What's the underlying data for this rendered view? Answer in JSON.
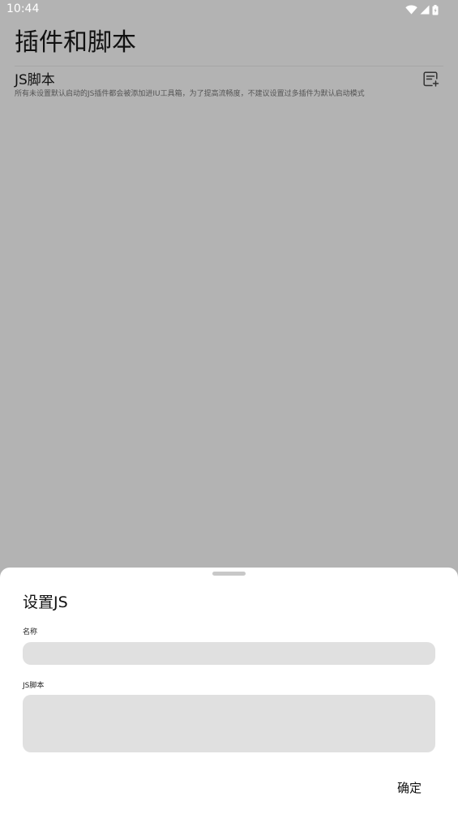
{
  "status_bar": {
    "time": "10:44",
    "icons": [
      "wifi-icon",
      "signal-icon",
      "battery-icon"
    ]
  },
  "page": {
    "title": "插件和脚本",
    "section": {
      "title": "JS脚本",
      "description": "所有未设置默认启动的JS插件都会被添加进IU工具箱，为了提高流畅度，不建议设置过多插件为默认启动模式",
      "action_icon": "add-note-icon"
    }
  },
  "sheet": {
    "title": "设置JS",
    "name_label": "名称",
    "name_value": "",
    "js_label": "JS脚本",
    "js_value": "",
    "confirm_label": "确定"
  },
  "colors": {
    "scrim_background": "#b3b3b3",
    "sheet_background": "#ffffff",
    "field_background": "#e0e0e0",
    "handle": "#c8c8c8"
  }
}
